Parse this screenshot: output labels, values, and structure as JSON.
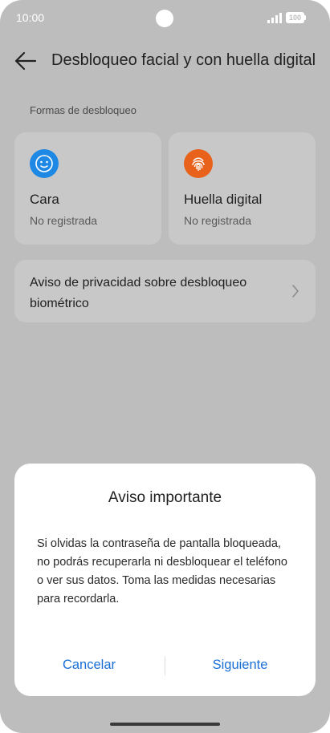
{
  "status_bar": {
    "time": "10:00",
    "battery_level": "100",
    "icons": [
      "signal-icon",
      "battery-icon"
    ]
  },
  "header": {
    "back_icon": "arrow-left-icon",
    "title": "Desbloqueo facial y con huella digital"
  },
  "section": {
    "label": "Formas de desbloqueo"
  },
  "unlock_methods": [
    {
      "title": "Cara",
      "status": "No registrada",
      "icon": "face-icon",
      "icon_color": "#1e88e5"
    },
    {
      "title": "Huella digital",
      "status": "No registrada",
      "icon": "fingerprint-icon",
      "icon_color": "#e8621c"
    }
  ],
  "privacy_notice": {
    "label": "Aviso de privacidad sobre desbloqueo biométrico",
    "icon": "chevron-right-icon"
  },
  "dialog": {
    "title": "Aviso importante",
    "body": "Si olvidas la contraseña de pantalla bloqueada, no podrás recuperarla ni desbloquear el teléfono o ver sus datos. Toma las medidas necesarias para recordarla.",
    "cancel_label": "Cancelar",
    "next_label": "Siguiente",
    "accent_color": "#1a6fd6"
  }
}
